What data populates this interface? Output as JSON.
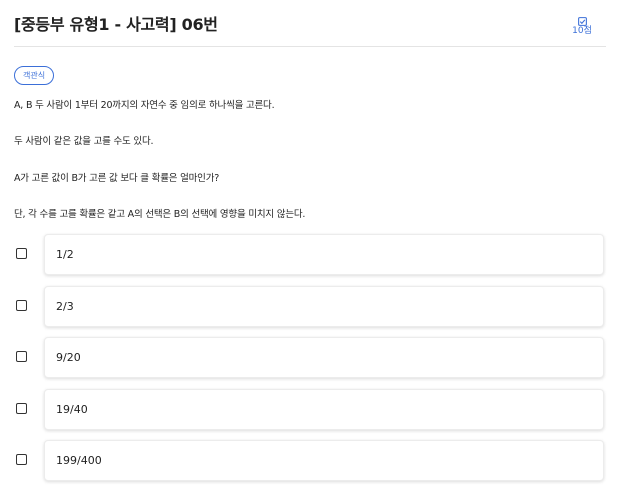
{
  "header": {
    "title": "[중등부 유형1 - 사고력] 06번",
    "score_icon": "checkbox-icon",
    "score": "10점"
  },
  "badge": "객관식",
  "question": {
    "lines": [
      "A, B 두 사람이 1부터 20까지의 자연수 중 임의로 하나씩을 고른다.",
      "두 사람이 같은 값을 고를 수도 있다.",
      "A가 고른 값이 B가 고른 값 보다 클 확률은 얼마인가?",
      "단, 각 수를 고를 확률은 같고 A의 선택은 B의 선택에 영향을 미치지 않는다."
    ]
  },
  "options": [
    {
      "label": "1/2",
      "checked": false
    },
    {
      "label": "2/3",
      "checked": false
    },
    {
      "label": "9/20",
      "checked": false
    },
    {
      "label": "19/40",
      "checked": false
    },
    {
      "label": "199/400",
      "checked": false
    }
  ],
  "colors": {
    "accent": "#3b6fd8",
    "text": "#222222",
    "divider": "#e4e4e4"
  }
}
